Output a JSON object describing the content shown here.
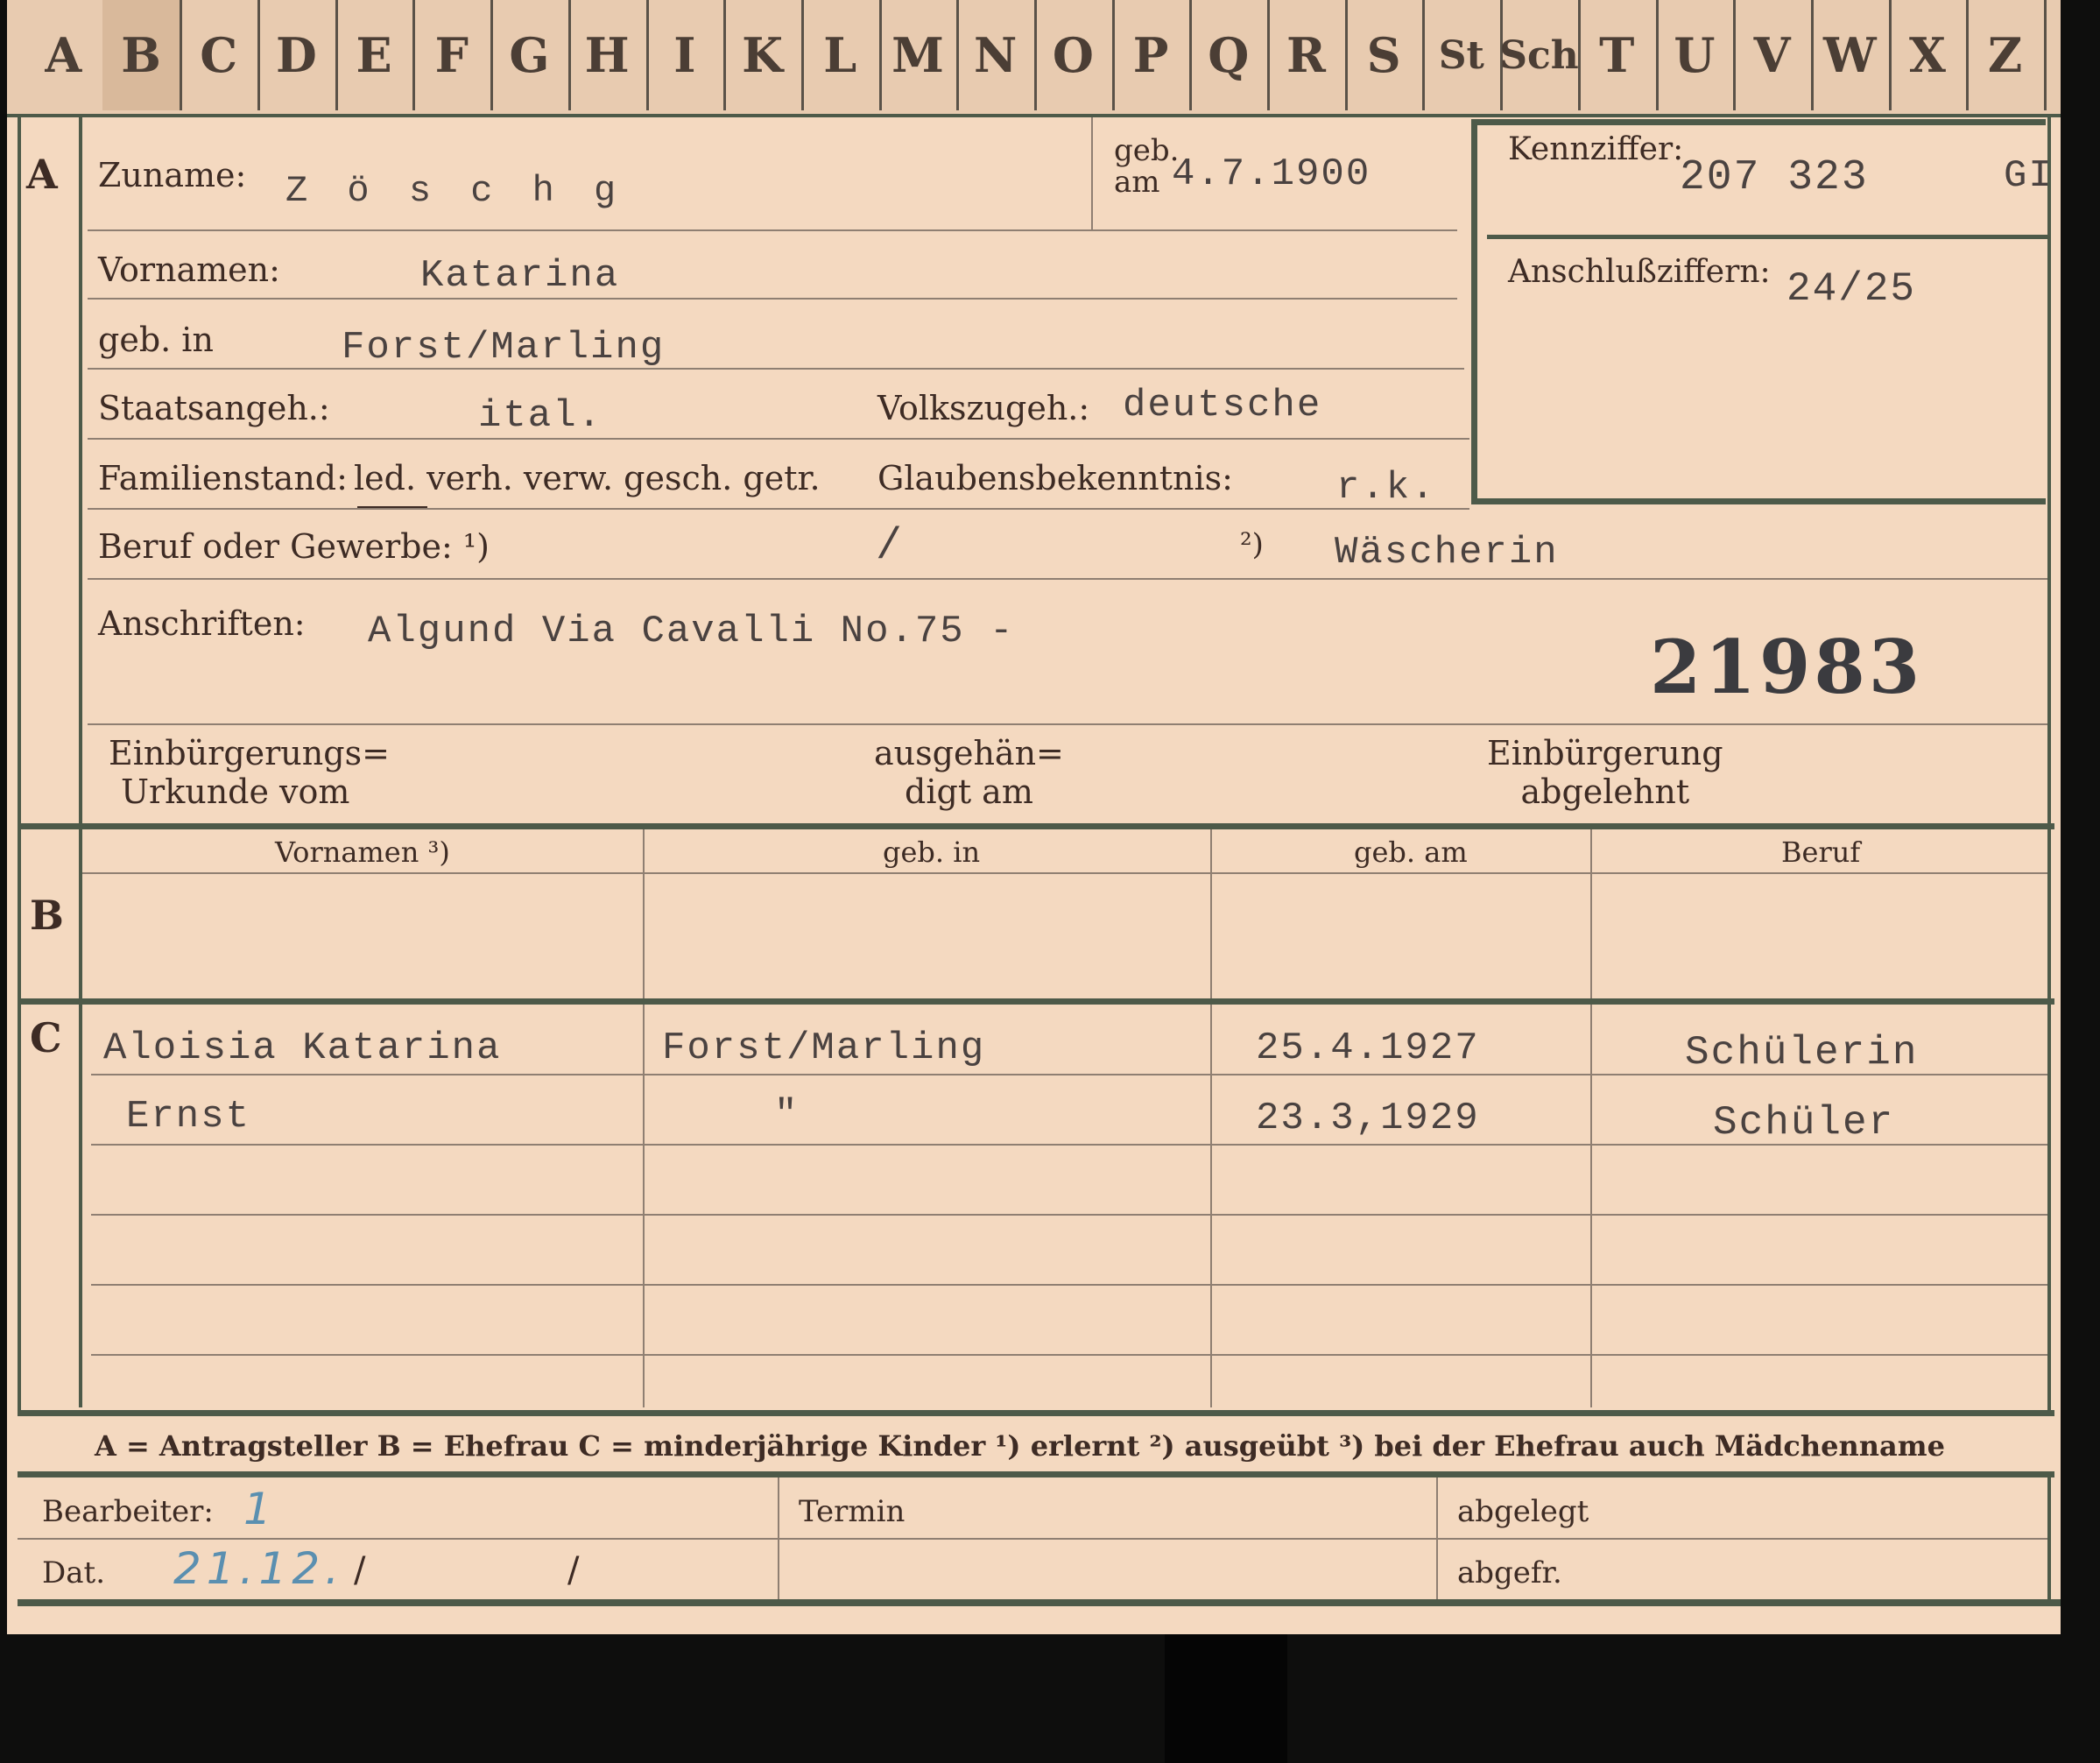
{
  "tabs": [
    "A",
    "B",
    "C",
    "D",
    "E",
    "F",
    "G",
    "H",
    "I",
    "K",
    "L",
    "M",
    "N",
    "O",
    "P",
    "Q",
    "R",
    "S",
    "St",
    "Sch",
    "T",
    "U",
    "V",
    "W",
    "X",
    "Z"
  ],
  "sections": {
    "a": "A",
    "b": "B",
    "c": "C"
  },
  "header": {
    "surname_label": "Zuname:",
    "surname_value": "Z ö s c h g",
    "dob_label_top": "geb.",
    "dob_label_bottom": "am",
    "dob_value": "4.7.1900",
    "kennziffer_label": "Kennziffer:",
    "kennziffer_value": "207 323",
    "kennziffer_suffix": "GI",
    "anschluss_label": "Anschlußziffern:",
    "anschluss_value": "24/25"
  },
  "person": {
    "vornamen_label": "Vornamen:",
    "vornamen_value": "Katarina",
    "geb_in_label": "geb. in",
    "geb_in_value": "Forst/Marling",
    "staat_label": "Staatsangeh.:",
    "staat_value": "ital.",
    "volk_label": "Volkszugeh.:",
    "volk_value": "deutsche",
    "familienstand_label": "Familienstand:",
    "familienstand_options": "led. verh. verw. gesch. getr.",
    "glauben_label": "Glaubensbekenntnis:",
    "glauben_value": "r.k.",
    "beruf_label": "Beruf oder Gewerbe: ¹)",
    "beruf_1_value": "/",
    "beruf_2_marker": "²)",
    "beruf_2_value": "Wäscherin",
    "anschriften_label": "Anschriften:",
    "anschriften_value": "Algund Via Cavalli No.75 -",
    "stamp_number": "21983",
    "einb_urkunde_line1": "Einbürgerungs=",
    "einb_urkunde_line2": "Urkunde vom",
    "ausgehaendigt_line1": "ausgehän=",
    "ausgehaendigt_line2": "digt am",
    "einb_abgelehnt_line1": "Einbürgerung",
    "einb_abgelehnt_line2": "abgelehnt"
  },
  "family_table": {
    "headers": [
      "Vornamen ³)",
      "geb. in",
      "geb. am",
      "Beruf"
    ],
    "children": [
      {
        "name": "Aloisia Katarina",
        "place": "Forst/Marling",
        "date": "25.4.1927",
        "job": "Schülerin"
      },
      {
        "name": "Ernst",
        "place": "\"",
        "date": "23.3,1929",
        "job": "Schüler"
      }
    ]
  },
  "legend": "A = Antragsteller   B = Ehefrau   C = minderjährige Kinder   ¹) erlernt   ²) ausgeübt   ³) bei der Ehefrau auch Mädchenname",
  "footer": {
    "bearbeiter_label": "Bearbeiter:",
    "bearbeiter_value": "1",
    "termin_label": "Termin",
    "abgelegt_label": "abgelegt",
    "dat_label": "Dat.",
    "dat_value": "21.12.",
    "dat_slash1": "/",
    "dat_slash2": "/",
    "abgefr_label": "abgefr."
  }
}
